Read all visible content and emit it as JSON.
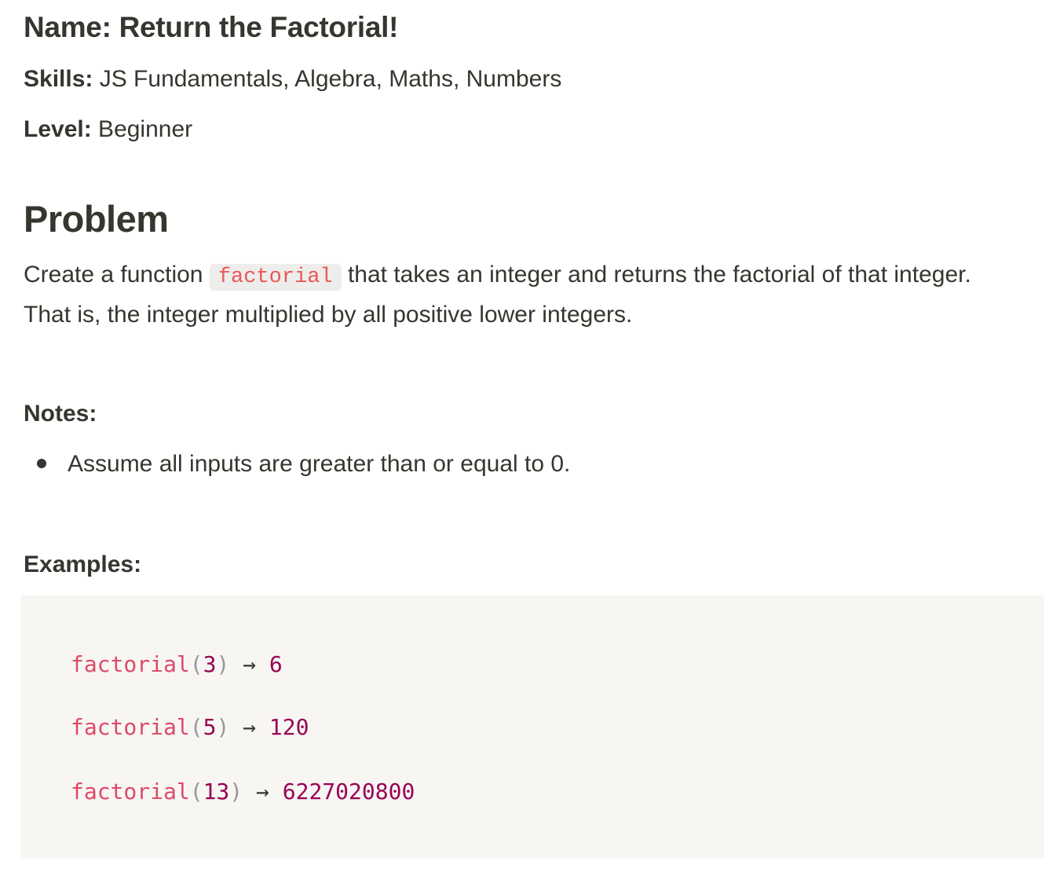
{
  "meta": {
    "name_label": "Name: Return the Factorial!",
    "skills_key": "Skills:",
    "skills_value": " JS Fundamentals, Algebra, Maths, Numbers",
    "level_key": "Level:",
    "level_value": " Beginner"
  },
  "problem": {
    "heading": "Problem",
    "text_before": "Create a function ",
    "inline_code": "factorial",
    "text_after": " that takes an integer and returns the factorial of that integer. That is, the integer multiplied by all positive lower integers."
  },
  "notes": {
    "heading": "Notes:",
    "items": [
      "Assume all inputs are greater than or equal to 0."
    ]
  },
  "examples": {
    "heading": "Examples:",
    "lines": [
      {
        "fn": "factorial",
        "open": "(",
        "arg": "3",
        "close": ")",
        "arrow": " → ",
        "result": "6"
      },
      {
        "fn": "factorial",
        "open": "(",
        "arg": "5",
        "close": ")",
        "arrow": " → ",
        "result": "120"
      },
      {
        "fn": "factorial",
        "open": "(",
        "arg": "13",
        "close": ")",
        "arrow": " → ",
        "result": "6227020800"
      }
    ]
  },
  "colors": {
    "text": "#37352f",
    "inline_code": "#eb5757",
    "code_bg": "#f7f6f3",
    "code_fn": "#dd4a68",
    "code_number": "#990055",
    "code_punctuation": "#999999"
  }
}
